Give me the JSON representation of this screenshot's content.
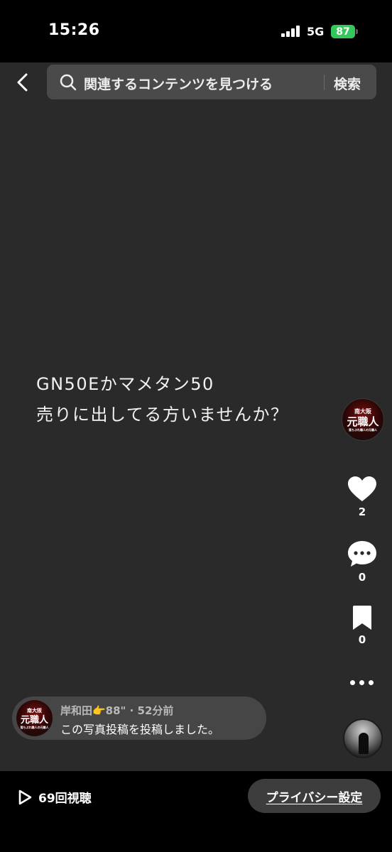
{
  "status_bar": {
    "time": "15:26",
    "network": "5G",
    "battery": "87"
  },
  "header": {
    "back_icon": "chevron-left-icon",
    "search_placeholder": "関連するコンテンツを見つける",
    "search_button": "検索"
  },
  "post": {
    "line1": "GN50Eかマメタン50",
    "line2": "売りに出してる方いませんか？"
  },
  "creator": {
    "avatar_logo_lines": [
      "南大阪",
      "元職人",
      "落ちぶれ職人の元職人"
    ]
  },
  "actions": {
    "like": {
      "icon": "heart-icon",
      "count": "2"
    },
    "comment": {
      "icon": "comment-icon",
      "count": "0"
    },
    "bookmark": {
      "icon": "bookmark-icon",
      "count": "0"
    },
    "more_icon": "more-dots-icon"
  },
  "activity": {
    "meta": "岸和田👉88\" · 52分前",
    "message": "この写真投稿を投稿しました。"
  },
  "bottom": {
    "views": "69回視聴",
    "privacy": "プライバシー設定"
  },
  "colors": {
    "background": "#2a2a2a",
    "bar": "#000000",
    "battery": "#34c759",
    "pill": "#464646"
  }
}
